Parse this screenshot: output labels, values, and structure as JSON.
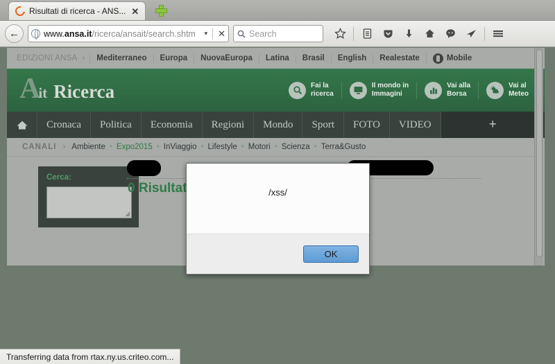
{
  "browser": {
    "tab": {
      "title": "Risultati di ricerca - ANS...",
      "close": "✕",
      "favicon": "firefox-icon"
    },
    "newtab_label": "+",
    "back_glyph": "←",
    "url": {
      "prefix": "www.",
      "host": "ansa.it",
      "path": "/ricerca/ansait/search.shtm",
      "dropdown": "▾",
      "stop": "✕"
    },
    "search": {
      "placeholder": "Search"
    },
    "toolbar_icons": [
      "bookmark-star-icon",
      "reading-list-icon",
      "pocket-icon",
      "download-icon",
      "home-icon",
      "chat-icon",
      "send-icon",
      "menu-icon"
    ]
  },
  "page": {
    "edizioni": {
      "label": "EDIZIONI ANSA",
      "caret": "›",
      "items": [
        "Mediterraneo",
        "Europa",
        "NuovaEuropa",
        "Latina",
        "Brasil",
        "English",
        "Realestate"
      ],
      "mobile": "Mobile"
    },
    "header": {
      "logo_a": "A",
      "logo_it": "it",
      "logo_ricerca": "Ricerca",
      "actions": [
        {
          "line1": "Fai la",
          "line2": "ricerca",
          "icon": "magnifier-icon"
        },
        {
          "line1": "Il mondo in",
          "line2": "Immagini",
          "icon": "image-screen-icon"
        },
        {
          "line1": "Vai alla",
          "line2": "Borsa",
          "icon": "bar-chart-icon"
        },
        {
          "line1": "Vai al",
          "line2": "Meteo",
          "icon": "weather-sun-cloud-icon"
        }
      ]
    },
    "nav": {
      "home_icon": "home-icon",
      "items": [
        "Cronaca",
        "Politica",
        "Economia",
        "Regioni",
        "Mondo",
        "Sport",
        "FOTO",
        "VIDEO"
      ],
      "plus": "+"
    },
    "canali": {
      "label": "CANALI",
      "caret": "›",
      "items": [
        "Ambiente",
        "Expo2015",
        "InViaggio",
        "Lifestyle",
        "Motori",
        "Scienza",
        "Terra&Gusto"
      ],
      "highlight": "Expo2015",
      "separator": "•"
    },
    "search_panel": {
      "label": "Cerca:",
      "input_value": ""
    },
    "results": {
      "count_text": "0 Risultati",
      "redacted_1": "",
      "redacted_2": ""
    }
  },
  "dialog": {
    "message": "/xss/",
    "ok_label": "OK"
  },
  "status": {
    "text": "Transferring data from rtax.ny.us.criteo.com..."
  }
}
